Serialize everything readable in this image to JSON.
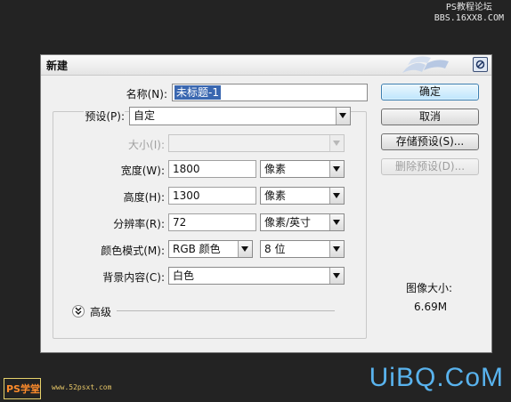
{
  "watermark_top": {
    "line1": "PS教程论坛",
    "line2": "BBS.16XX8.COM"
  },
  "dialog": {
    "title": "新建",
    "name": {
      "label": "名称(N):",
      "value": "未标题-1"
    },
    "preset": {
      "label": "预设(P):",
      "value": "自定"
    },
    "size": {
      "label": "大小(I):",
      "value": ""
    },
    "width": {
      "label": "宽度(W):",
      "value": "1800",
      "unit": "像素"
    },
    "height": {
      "label": "高度(H):",
      "value": "1300",
      "unit": "像素"
    },
    "resolution": {
      "label": "分辨率(R):",
      "value": "72",
      "unit": "像素/英寸"
    },
    "color_mode": {
      "label": "颜色模式(M):",
      "value": "RGB 颜色",
      "depth": "8 位"
    },
    "background": {
      "label": "背景内容(C):",
      "value": "白色"
    },
    "advanced": {
      "label": "高级"
    },
    "buttons": {
      "ok": "确定",
      "cancel": "取消",
      "save_preset": "存储预设(S)...",
      "delete_preset": "删除预设(D)..."
    },
    "image_size": {
      "label": "图像大小:",
      "value": "6.69M"
    }
  },
  "watermark_bottom_left": {
    "logo": "PS学堂",
    "url": "www.52psxt.com"
  },
  "watermark_bottom_right": "UiBQ.CoM"
}
